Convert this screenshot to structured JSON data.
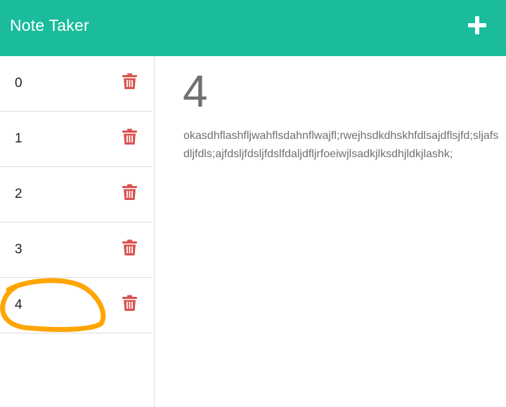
{
  "app": {
    "title": "Note Taker",
    "add_icon": "plus-icon"
  },
  "notes": [
    {
      "title": "0",
      "delete_icon": "trash-icon"
    },
    {
      "title": "1",
      "delete_icon": "trash-icon"
    },
    {
      "title": "2",
      "delete_icon": "trash-icon"
    },
    {
      "title": "3",
      "delete_icon": "trash-icon"
    },
    {
      "title": "4",
      "delete_icon": "trash-icon"
    }
  ],
  "active_note": {
    "title": "4",
    "text": "okasdhflashfljwahflsdahnflwajfl;rwejhsdkdhskhfdlsajdflsjfd;sljafsdljfdls;ajfdsljfdsljfdslfdaljdfljrfoeiwjlsadkjlksdhjldkjlashk;"
  },
  "colors": {
    "navbar": "#1abc9c",
    "trash": "#d9534f",
    "highlight": "#ffa500"
  }
}
